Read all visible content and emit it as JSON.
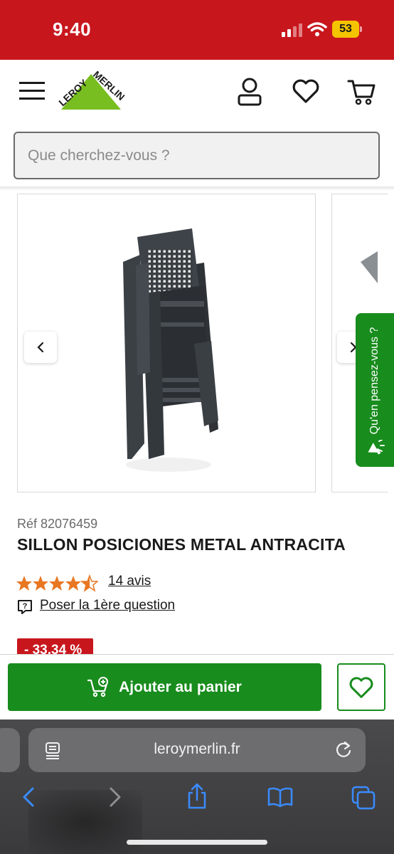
{
  "status_bar": {
    "time": "9:40",
    "battery": "53"
  },
  "header": {
    "logo_text": "LEROY MERLIN",
    "search_placeholder": "Que cherchez-vous ?"
  },
  "feedback_tab": {
    "label": "Qu'en pensez-vous ?"
  },
  "product": {
    "ref": "Réf 82076459",
    "title": "SILLON POSICIONES METAL ANTRACITA",
    "rating": 4.5,
    "rating_max": 5,
    "reviews_label": "14 avis",
    "ask_label": "Poser la 1ère question",
    "discount": "- 33,34 %"
  },
  "actions": {
    "add_to_cart": "Ajouter au panier"
  },
  "browser": {
    "url": "leroymerlin.fr"
  },
  "colors": {
    "brand_red": "#c8161d",
    "brand_green": "#188c1d",
    "star": "#e87722"
  }
}
